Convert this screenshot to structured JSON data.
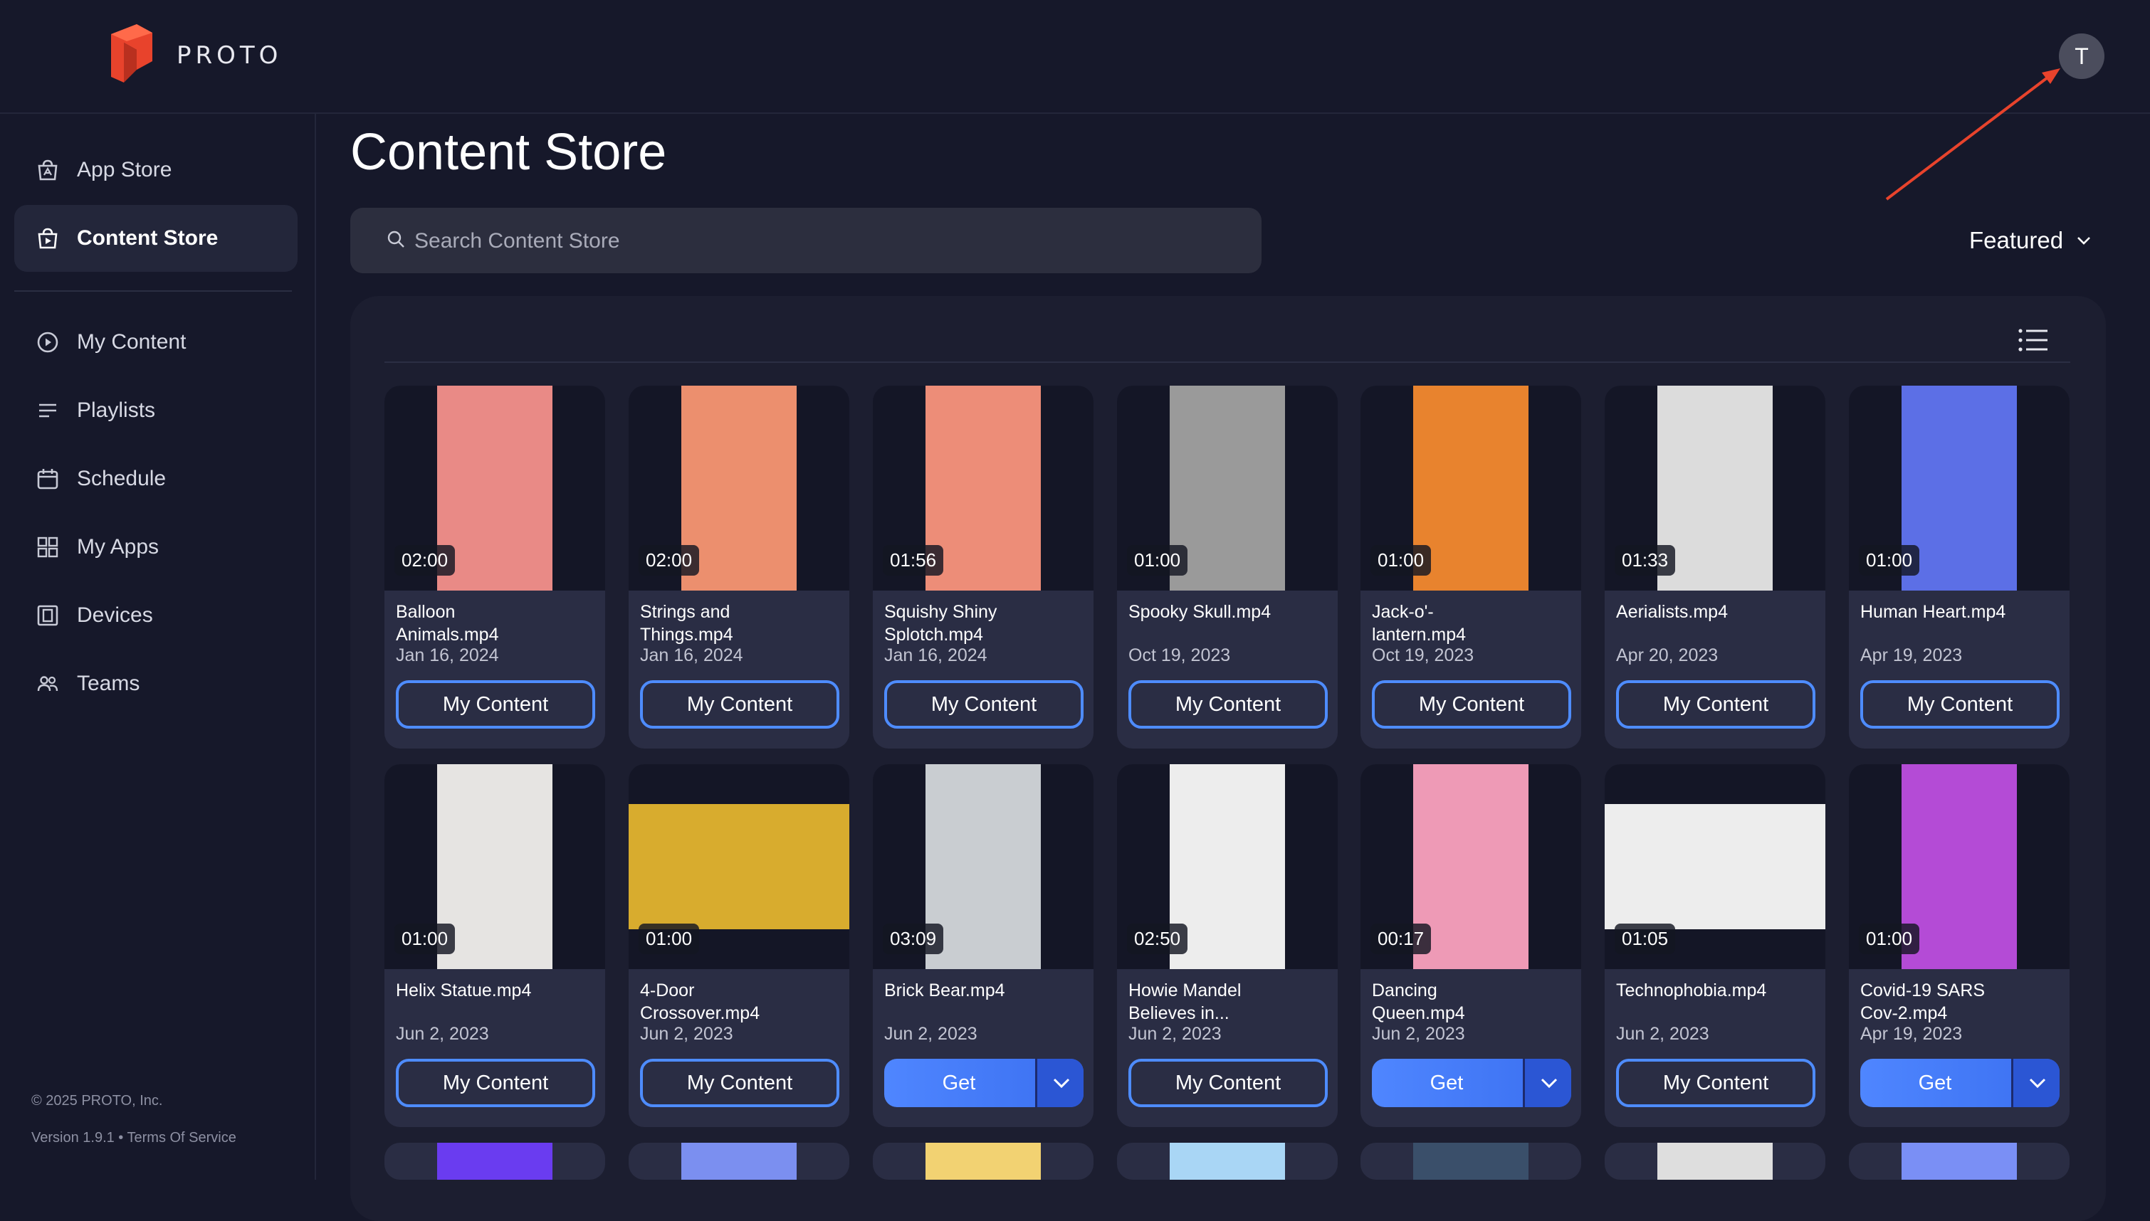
{
  "brand": {
    "name": "PROTO",
    "logo_color": "#e8432c"
  },
  "user": {
    "initial": "T"
  },
  "sidebar": {
    "top_items": [
      {
        "label": "App Store",
        "icon": "app-store-icon"
      },
      {
        "label": "Content Store",
        "icon": "content-store-icon",
        "active": true
      }
    ],
    "items": [
      {
        "label": "My Content",
        "icon": "play-circle-icon"
      },
      {
        "label": "Playlists",
        "icon": "playlist-icon"
      },
      {
        "label": "Schedule",
        "icon": "calendar-icon"
      },
      {
        "label": "My Apps",
        "icon": "apps-grid-icon"
      },
      {
        "label": "Devices",
        "icon": "device-icon"
      },
      {
        "label": "Teams",
        "icon": "team-icon"
      }
    ],
    "footer": {
      "copyright": "© 2025 PROTO, Inc.",
      "version": "Version 1.9.1 • Terms Of Service"
    }
  },
  "main": {
    "title": "Content Store",
    "search_placeholder": "Search Content Store",
    "sort_label": "Featured",
    "accent_color": "#4e8cff",
    "button_labels": {
      "my_content": "My Content",
      "get": "Get"
    },
    "cards": [
      {
        "name": "Balloon\nAnimals.mp4",
        "date": "Jan 16, 2024",
        "duration": "02:00",
        "action": "my_content",
        "thumb_bg": "#e98a86"
      },
      {
        "name": "Strings and\nThings.mp4",
        "date": "Jan 16, 2024",
        "duration": "02:00",
        "action": "my_content",
        "thumb_bg": "#ec8f6e"
      },
      {
        "name": "Squishy Shiny\nSplotch.mp4",
        "date": "Jan 16, 2024",
        "duration": "01:56",
        "action": "my_content",
        "thumb_bg": "#ed8d78"
      },
      {
        "name": "Spooky Skull.mp4",
        "date": "Oct 19, 2023",
        "duration": "01:00",
        "action": "my_content",
        "thumb_bg": "#9a9a9a"
      },
      {
        "name": "Jack-o'-\nlantern.mp4",
        "date": "Oct 19, 2023",
        "duration": "01:00",
        "action": "my_content",
        "thumb_bg": "#e8832e"
      },
      {
        "name": "Aerialists.mp4",
        "date": "Apr 20, 2023",
        "duration": "01:33",
        "action": "my_content",
        "thumb_bg": "#dcdcdc"
      },
      {
        "name": "Human Heart.mp4",
        "date": "Apr 19, 2023",
        "duration": "01:00",
        "action": "my_content",
        "thumb_bg": "#5c6fe6"
      },
      {
        "name": "Helix Statue.mp4",
        "date": "Jun 2, 2023",
        "duration": "01:00",
        "action": "my_content",
        "thumb_bg": "#e6e4e2"
      },
      {
        "name": "4-Door\nCrossover.mp4",
        "date": "Jun 2, 2023",
        "duration": "01:00",
        "action": "my_content",
        "thumb_bg": "#d8ac2e"
      },
      {
        "name": "Brick Bear.mp4",
        "date": "Jun 2, 2023",
        "duration": "03:09",
        "action": "get",
        "thumb_bg": "#c9cdd1"
      },
      {
        "name": "Howie Mandel\nBelieves in...",
        "date": "Jun 2, 2023",
        "duration": "02:50",
        "action": "my_content",
        "thumb_bg": "#ededed"
      },
      {
        "name": "Dancing\nQueen.mp4",
        "date": "Jun 2, 2023",
        "duration": "00:17",
        "action": "get",
        "thumb_bg": "#ee9ab6"
      },
      {
        "name": "Technophobia.mp4",
        "date": "Jun 2, 2023",
        "duration": "01:05",
        "action": "my_content",
        "thumb_bg": "#ededed"
      },
      {
        "name": "Covid-19 SARS\nCov-2.mp4",
        "date": "Apr 19, 2023",
        "duration": "01:00",
        "action": "get",
        "thumb_bg": "#b44bd6"
      }
    ],
    "partial_row_colors": [
      "#6a3cf0",
      "#7b8ff0",
      "#f2d272",
      "#a9d6f5",
      "#3a4f6a",
      "#dedede",
      "#7a8ff5"
    ]
  }
}
